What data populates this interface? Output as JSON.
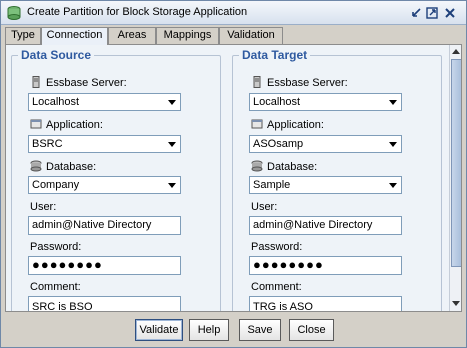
{
  "window": {
    "title": "Create Partition for Block Storage Application"
  },
  "tabs": [
    {
      "label": "Type"
    },
    {
      "label": "Connection"
    },
    {
      "label": "Areas"
    },
    {
      "label": "Mappings"
    },
    {
      "label": "Validation"
    }
  ],
  "source": {
    "title": "Data Source",
    "server_label": "Essbase Server:",
    "server_value": "Localhost",
    "application_label": "Application:",
    "application_value": "BSRC",
    "database_label": "Database:",
    "database_value": "Company",
    "user_label": "User:",
    "user_value": "admin@Native Directory",
    "password_label": "Password:",
    "password_value": "●●●●●●●●",
    "comment_label": "Comment:",
    "comment_value": "SRC is BSO"
  },
  "target": {
    "title": "Data Target",
    "server_label": "Essbase Server:",
    "server_value": "Localhost",
    "application_label": "Application:",
    "application_value": "ASOsamp",
    "database_label": "Database:",
    "database_value": "Sample",
    "user_label": "User:",
    "user_value": "admin@Native Directory",
    "password_label": "Password:",
    "password_value": "●●●●●●●●",
    "comment_label": "Comment:",
    "comment_value": "TRG is ASO"
  },
  "buttons": {
    "validate": "Validate",
    "help": "Help",
    "save": "Save",
    "close": "Close"
  },
  "colors": {
    "group_title": "#2f5aa0",
    "panel_bg": "#eef3f8",
    "window_bg": "#d4d0c8"
  }
}
